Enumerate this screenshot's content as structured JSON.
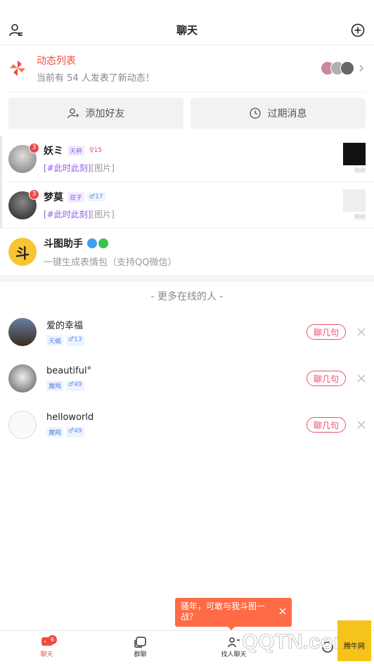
{
  "header": {
    "title": "聊天"
  },
  "feed": {
    "title": "动态列表",
    "subtitle": "当前有 54 人发表了新动态！"
  },
  "actions": {
    "add_friend": "添加好友",
    "expired": "过期消息"
  },
  "chats": [
    {
      "name": "妖ミ",
      "badge": "3",
      "zodiac": "天秤",
      "tag2": "♀​15",
      "topic": "[#此时此刻]",
      "preview": "[图片]",
      "time": "刚刚"
    },
    {
      "name": "梦莫",
      "badge": "3",
      "zodiac": "双子",
      "tag2": "♂​17",
      "topic": "[#此时此刻]",
      "preview": "[图片]",
      "time": "刚刚"
    }
  ],
  "helper": {
    "name": "斗图助手",
    "avatar_char": "斗",
    "desc": "一键生成表情包（支持QQ微信）"
  },
  "online": {
    "title": "- 更多在线的人 -",
    "people": [
      {
        "name": "爱的幸福",
        "zodiac": "天蝎",
        "age": "♂​13",
        "button": "聊几句"
      },
      {
        "name": "beautiful°",
        "zodiac": "魔羯",
        "age": "♂​49",
        "button": "聊几句"
      },
      {
        "name": "helloworld",
        "zodiac": "魔羯",
        "age": "♂​49",
        "button": "聊几句"
      }
    ]
  },
  "toast": {
    "text": "骚年，可敢与我斗图一战？"
  },
  "tabs": {
    "chat": "聊天",
    "chat_badge": "6",
    "group": "群聊",
    "find": "找人聊天"
  },
  "watermark": {
    "text": "QQTN.com",
    "brand": "腾牛网"
  },
  "colors": {
    "accent": "#f04e3e",
    "topic": "#8f5de8",
    "toast": "#ff6a47"
  }
}
